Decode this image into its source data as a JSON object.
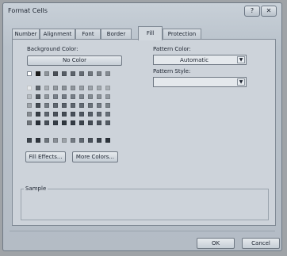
{
  "window": {
    "title": "Format Cells",
    "help_glyph": "?",
    "close_glyph": "✕"
  },
  "tabs": [
    {
      "label": "Number",
      "active": false
    },
    {
      "label": "Alignment",
      "active": false
    },
    {
      "label": "Font",
      "active": false
    },
    {
      "label": "Border",
      "active": false
    },
    {
      "label": "Fill",
      "active": true
    },
    {
      "label": "Protection",
      "active": false
    }
  ],
  "fill": {
    "background_color_label": "Background Color:",
    "no_color_label": "No Color",
    "fill_effects_label": "Fill Effects...",
    "more_colors_label": "More Colors...",
    "pattern_color_label": "Pattern Color:",
    "pattern_color_value": "Automatic",
    "pattern_style_label": "Pattern Style:",
    "pattern_style_value": "",
    "sample_label": "Sample"
  },
  "palette": {
    "top_row": [
      "#ffffff",
      "#1c1c1c",
      "#8e949a",
      "#4a5058",
      "#565d66",
      "#5c636b",
      "#646b73",
      "#6f767d",
      "#7a8188",
      "#858c93"
    ],
    "theme_rows": [
      [
        "#e6e9ec",
        "#5d646c",
        "#a8aeb4",
        "#9299a0",
        "#8a9198",
        "#8e959c",
        "#959ca3",
        "#9ba2a9",
        "#a1a8ae",
        "#a9afb5"
      ],
      [
        "#b5bbc1",
        "#50575f",
        "#8f969d",
        "#78808a",
        "#737b84",
        "#767e87",
        "#7c848c",
        "#838b92",
        "#8a9198",
        "#939aa1"
      ],
      [
        "#9ca2a8",
        "#434a52",
        "#747c84",
        "#5f6770",
        "#59616a",
        "#5d656e",
        "#636b74",
        "#6a727a",
        "#737b83",
        "#7c848b"
      ],
      [
        "#868c92",
        "#363d45",
        "#5d656e",
        "#4a525b",
        "#444c55",
        "#48505a",
        "#4f5761",
        "#565e68",
        "#5f6770",
        "#687079"
      ],
      [
        "#6f757b",
        "#293038",
        "#474f58",
        "#363e47",
        "#30383f",
        "#343c45",
        "#3b434c",
        "#434b54",
        "#4b535c",
        "#545c65"
      ]
    ],
    "standard_row": [
      "#3f464e",
      "#2f363e",
      "#6e757c",
      "#8a9097",
      "#9da3a9",
      "#747b83",
      "#5f6770",
      "#4a525b",
      "#3a424b",
      "#2d343c"
    ]
  },
  "footer": {
    "ok_label": "OK",
    "cancel_label": "Cancel"
  }
}
